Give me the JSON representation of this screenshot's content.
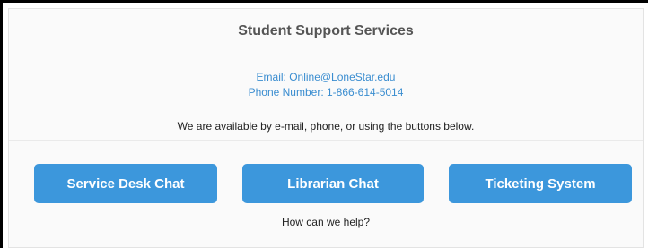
{
  "support": {
    "title": "Student Support Services",
    "email": "Email: Online@LoneStar.edu",
    "phone": "Phone Number: 1-866-614-5014",
    "availability": "We are available by e-mail, phone, or using the buttons below.",
    "buttons": [
      {
        "label": "Service Desk Chat"
      },
      {
        "label": "Librarian Chat"
      },
      {
        "label": "Ticketing System"
      }
    ],
    "help": "How can we help?"
  },
  "colors": {
    "button": "#3c97dc",
    "link": "#3a8dd0",
    "title": "#555555"
  }
}
